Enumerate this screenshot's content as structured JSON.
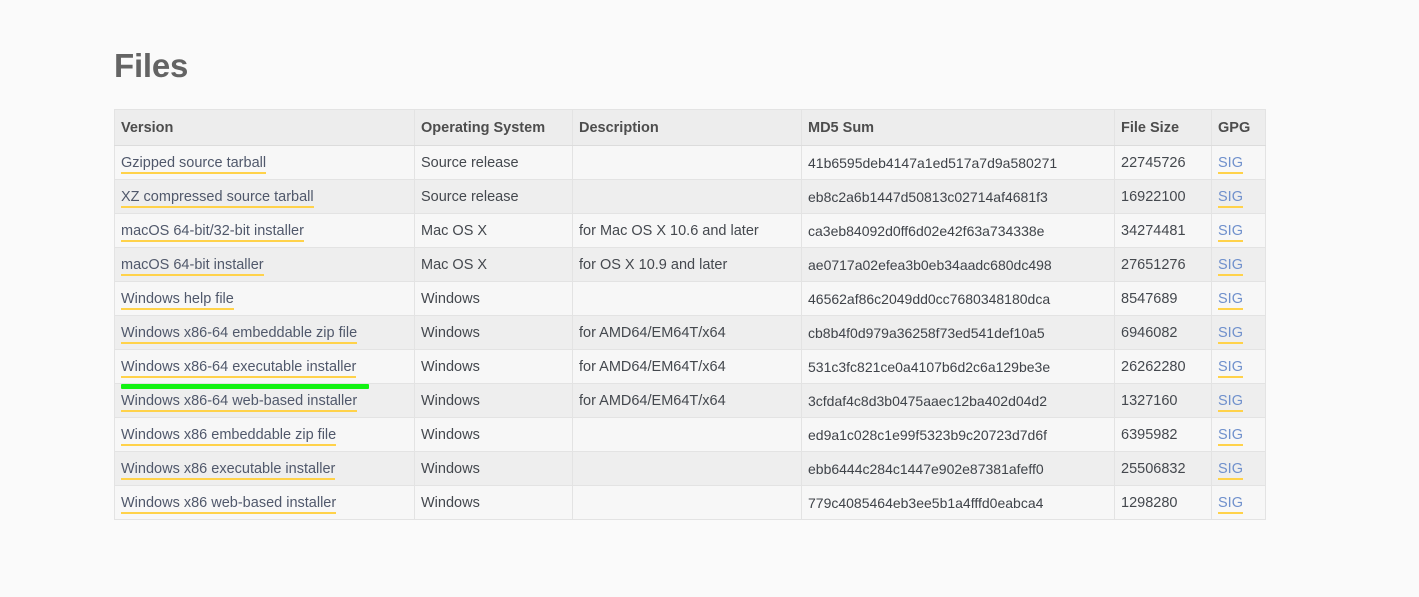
{
  "page": {
    "title": "Files",
    "background_color": "#fafafa"
  },
  "table": {
    "headers": [
      "Version",
      "Operating System",
      "Description",
      "MD5 Sum",
      "File Size",
      "GPG"
    ],
    "gpg_link_label": "SIG",
    "rows": [
      {
        "version": "Gzipped source tarball",
        "os": "Source release",
        "description": "",
        "md5": "41b6595deb4147a1ed517a7d9a580271",
        "size": "22745726",
        "gpg": "SIG"
      },
      {
        "version": "XZ compressed source tarball",
        "os": "Source release",
        "description": "",
        "md5": "eb8c2a6b1447d50813c02714af4681f3",
        "size": "16922100",
        "gpg": "SIG"
      },
      {
        "version": "macOS 64-bit/32-bit installer",
        "os": "Mac OS X",
        "description": "for Mac OS X 10.6 and later",
        "md5": "ca3eb84092d0ff6d02e42f63a734338e",
        "size": "34274481",
        "gpg": "SIG"
      },
      {
        "version": "macOS 64-bit installer",
        "os": "Mac OS X",
        "description": "for OS X 10.9 and later",
        "md5": "ae0717a02efea3b0eb34aadc680dc498",
        "size": "27651276",
        "gpg": "SIG"
      },
      {
        "version": "Windows help file",
        "os": "Windows",
        "description": "",
        "md5": "46562af86c2049dd0cc7680348180dca",
        "size": "8547689",
        "gpg": "SIG"
      },
      {
        "version": "Windows x86-64 embeddable zip file",
        "os": "Windows",
        "description": "for AMD64/EM64T/x64",
        "md5": "cb8b4f0d979a36258f73ed541def10a5",
        "size": "6946082",
        "gpg": "SIG"
      },
      {
        "version": "Windows x86-64 executable installer",
        "os": "Windows",
        "description": "for AMD64/EM64T/x64",
        "md5": "531c3fc821ce0a4107b6d2c6a129be3e",
        "size": "26262280",
        "gpg": "SIG"
      },
      {
        "version": "Windows x86-64 web-based installer",
        "os": "Windows",
        "description": "for AMD64/EM64T/x64",
        "md5": "3cfdaf4c8d3b0475aaec12ba402d04d2",
        "size": "1327160",
        "gpg": "SIG"
      },
      {
        "version": "Windows x86 embeddable zip file",
        "os": "Windows",
        "description": "",
        "md5": "ed9a1c028c1e99f5323b9c20723d7d6f",
        "size": "6395982",
        "gpg": "SIG"
      },
      {
        "version": "Windows x86 executable installer",
        "os": "Windows",
        "description": "",
        "md5": "ebb6444c284c1447e902e87381afeff0",
        "size": "25506832",
        "gpg": "SIG"
      },
      {
        "version": "Windows x86 web-based installer",
        "os": "Windows",
        "description": "",
        "md5": "779c4085464eb3ee5b1a4fffd0eabca4",
        "size": "1298280",
        "gpg": "SIG"
      }
    ]
  },
  "annotation": {
    "color": "#12f312",
    "target_row_index": 6,
    "target_text": "Windows x86-64 executable installer"
  }
}
